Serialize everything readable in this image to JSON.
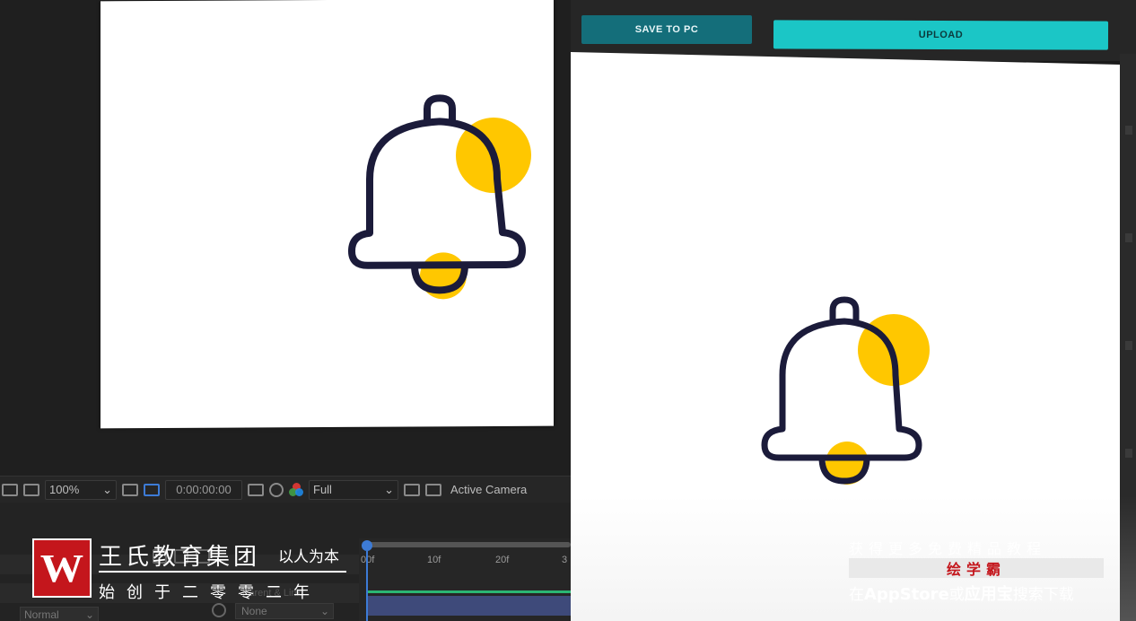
{
  "viewer_toolbar": {
    "zoom": "100%",
    "timecode": "0:00:00:00",
    "resolution": "Full",
    "camera": "Active Camera"
  },
  "timeline": {
    "ticks": [
      "00f",
      "10f",
      "20f",
      "3"
    ],
    "blend_mode": "Normal",
    "parent_label": "Parent & Link",
    "parent_value": "None"
  },
  "mockup": {
    "save_label": "SAVE TO PC",
    "upload_label": "UPLOAD"
  },
  "colors": {
    "bell_stroke": "#1b1b3a",
    "bell_dot": "#ffc700",
    "save_button": "#146e7a",
    "upload_button": "#1bc6c6",
    "brand_red": "#c4161c"
  },
  "icons": [
    "bell-icon",
    "notification-dot-icon",
    "camera-icon",
    "rgb-icon",
    "chevron-down-icon"
  ],
  "watermark_left": {
    "logo_letter": "W",
    "title": "王氏教育集团",
    "slogan": "以人为本",
    "subtitle": "始创于二零零二年"
  },
  "watermark_right": {
    "line1": "获得更多免费精品教程",
    "line2": "绘学霸",
    "line3_prefix": "在",
    "line3_store": "AppStore",
    "line3_mid": "或",
    "line3_app": "应用宝",
    "line3_suffix": "搜索下载"
  }
}
